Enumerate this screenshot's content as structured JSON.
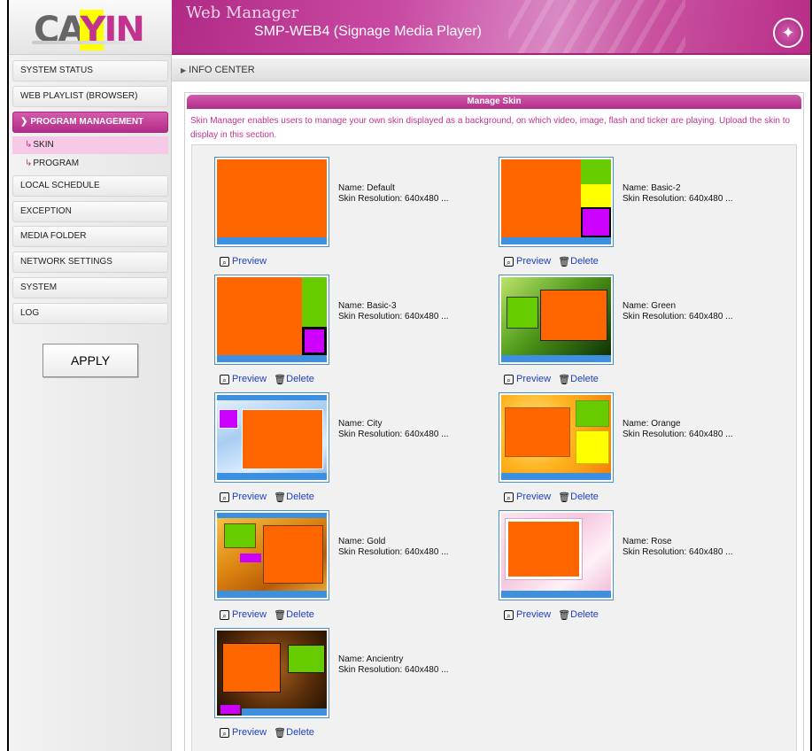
{
  "header": {
    "logo_text": "CAYIN",
    "banner_title": "Web Manager",
    "banner_subtitle": "SMP-WEB4 (Signage Media Player)"
  },
  "sidebar": {
    "items": [
      {
        "label": "SYSTEM STATUS"
      },
      {
        "label": "WEB PLAYLIST (BROWSER)"
      },
      {
        "label": "PROGRAM MANAGEMENT"
      },
      {
        "label": "SKIN"
      },
      {
        "label": "PROGRAM"
      },
      {
        "label": "LOCAL SCHEDULE"
      },
      {
        "label": "EXCEPTION"
      },
      {
        "label": "MEDIA FOLDER"
      },
      {
        "label": "NETWORK SETTINGS"
      },
      {
        "label": "SYSTEM"
      },
      {
        "label": "LOG"
      }
    ],
    "apply_label": "APPLY"
  },
  "main": {
    "breadcrumb": "INFO CENTER",
    "panel_title": "Manage Skin",
    "description": "Skin Manager enables users to manage your own skin displayed as a background, on which video, image, flash and ticker are playing. Upload the skin to display in this section.",
    "preview_label": "Preview",
    "delete_label": "Delete",
    "skins": [
      {
        "name": "Name: Default",
        "resolution": "Skin Resolution: 640x480 ..."
      },
      {
        "name": "Name: Basic-2",
        "resolution": "Skin Resolution: 640x480 ..."
      },
      {
        "name": "Name: Basic-3",
        "resolution": "Skin Resolution: 640x480 ..."
      },
      {
        "name": "Name: Green",
        "resolution": "Skin Resolution: 640x480 ..."
      },
      {
        "name": "Name: City",
        "resolution": "Skin Resolution: 640x480 ..."
      },
      {
        "name": "Name: Orange",
        "resolution": "Skin Resolution: 640x480 ..."
      },
      {
        "name": "Name: Gold",
        "resolution": "Skin Resolution: 640x480 ..."
      },
      {
        "name": "Name: Rose",
        "resolution": "Skin Resolution: 640x480 ..."
      },
      {
        "name": "Name: Ancientry",
        "resolution": "Skin Resolution: 640x480 ..."
      }
    ]
  },
  "colors": {
    "accent": "#b72f8a",
    "skin_orange": "#ff6600",
    "skin_green": "#66cc00",
    "skin_yellow": "#ffff00",
    "skin_purple": "#cc00ff",
    "skin_blue": "#3d8fe0",
    "link_blue": "#1f3fbf"
  }
}
